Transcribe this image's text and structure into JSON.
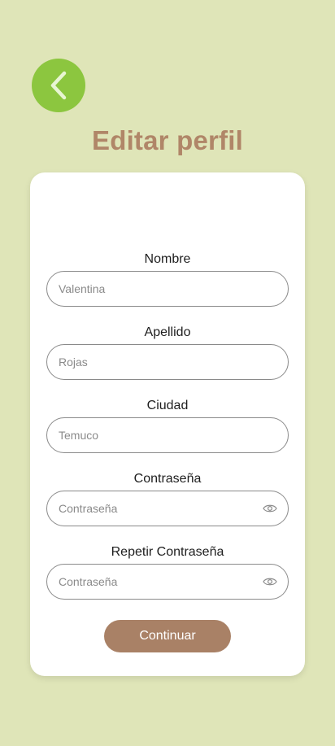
{
  "title": "Editar perfil",
  "fields": [
    {
      "label": "Nombre",
      "value": "Valentina"
    },
    {
      "label": "Apellido",
      "value": "Rojas"
    },
    {
      "label": "Ciudad",
      "value": "Temuco"
    },
    {
      "label": "Contraseña",
      "placeholder": "Contraseña"
    },
    {
      "label": "Repetir Contraseña",
      "placeholder": "Contraseña"
    }
  ],
  "continue_label": "Continuar",
  "colors": {
    "background": "#dfe5b8",
    "back_button": "#8cc63f",
    "title": "#b08668",
    "continue_button": "#a98166"
  },
  "icons": {
    "back": "chevron-left-icon",
    "password_toggle": "eye-icon"
  }
}
